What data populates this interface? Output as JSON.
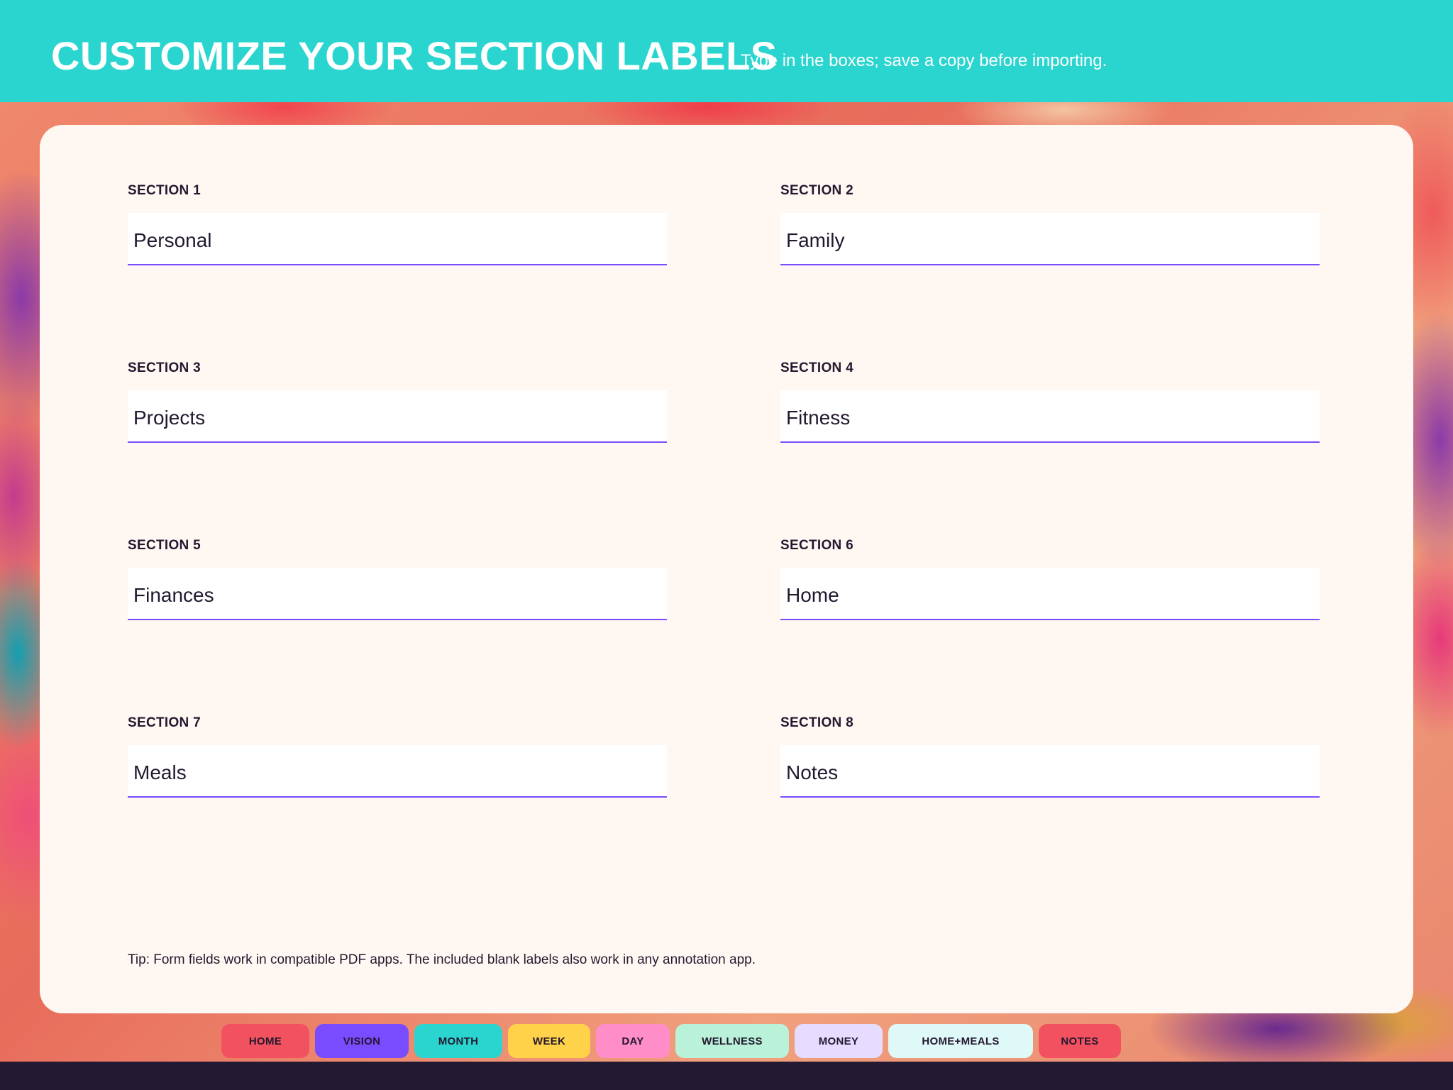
{
  "header": {
    "title": "CUSTOMIZE YOUR SECTION LABELS",
    "subtitle": "Type in the boxes; save a copy before importing."
  },
  "sections": [
    {
      "label": "SECTION 1",
      "value": "Personal"
    },
    {
      "label": "SECTION 2",
      "value": "Family"
    },
    {
      "label": "SECTION 3",
      "value": "Projects"
    },
    {
      "label": "SECTION 4",
      "value": "Fitness"
    },
    {
      "label": "SECTION 5",
      "value": "Finances"
    },
    {
      "label": "SECTION 6",
      "value": "Home"
    },
    {
      "label": "SECTION 7",
      "value": "Meals"
    },
    {
      "label": "SECTION 8",
      "value": "Notes"
    }
  ],
  "tip": "Tip: Form fields work in compatible PDF apps. The included blank labels also work in any annotation app.",
  "tabs": [
    {
      "label": "HOME",
      "color": "#f2525f"
    },
    {
      "label": "VISION",
      "color": "#7a4cff"
    },
    {
      "label": "MONTH",
      "color": "#2bd5cf"
    },
    {
      "label": "WEEK",
      "color": "#ffd24a"
    },
    {
      "label": "DAY",
      "color": "#ff8ec8"
    },
    {
      "label": "WELLNESS",
      "color": "#b9f2d8"
    },
    {
      "label": "MONEY",
      "color": "#e6dcff"
    },
    {
      "label": "HOME+MEALS",
      "color": "#dff8f8"
    },
    {
      "label": "NOTES",
      "color": "#f2525f"
    }
  ]
}
